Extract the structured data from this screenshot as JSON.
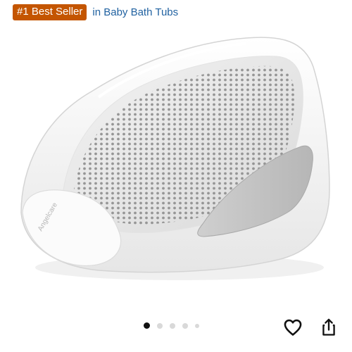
{
  "badge": {
    "label": "#1 Best Seller",
    "category_link": "in Baby Bath Tubs",
    "badge_color": "#C45500",
    "link_color": "#2162A1"
  },
  "product_image": {
    "brand_mark": "Angelcare"
  },
  "carousel": {
    "total_images": 5,
    "active_index": 0
  },
  "actions": {
    "icons": [
      "heart-icon",
      "share-icon"
    ]
  }
}
